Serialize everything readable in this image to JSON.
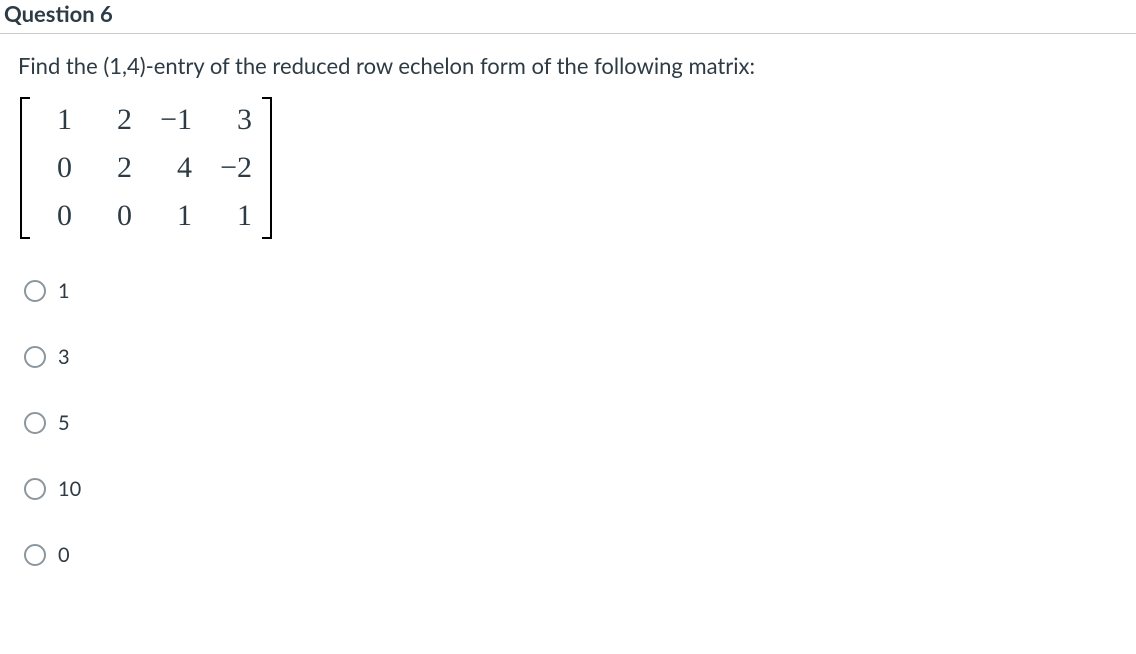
{
  "header": {
    "title": "Question 6"
  },
  "prompt": "Find the (1,4)-entry of the reduced row echelon form of the following matrix:",
  "matrix": {
    "r1c1": "1",
    "r1c2": "2",
    "r1c3": "−1",
    "r1c4": "3",
    "r2c1": "0",
    "r2c2": "2",
    "r2c3": "4",
    "r2c4": "−2",
    "r3c1": "0",
    "r3c2": "0",
    "r3c3": "1",
    "r3c4": "1"
  },
  "options": {
    "a": "1",
    "b": "3",
    "c": "5",
    "d": "10",
    "e": "0"
  }
}
